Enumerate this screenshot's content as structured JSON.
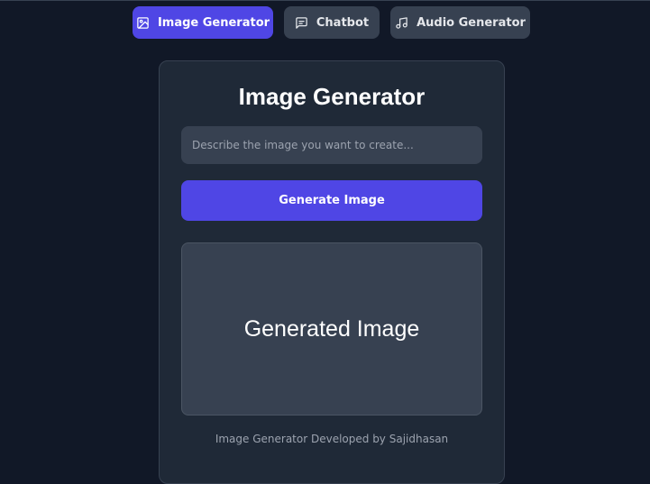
{
  "nav": {
    "tabs": [
      {
        "label": "Image Generator",
        "icon": "image-icon",
        "active": true
      },
      {
        "label": "Chatbot",
        "icon": "chat-icon",
        "active": false
      },
      {
        "label": "Audio Generator",
        "icon": "music-icon",
        "active": false
      }
    ]
  },
  "card": {
    "title": "Image Generator",
    "input_placeholder": "Describe the image you want to create...",
    "input_value": "",
    "button_label": "Generate Image",
    "image_placeholder": "Generated Image",
    "footer": "Image Generator Developed by Sajidhasan"
  },
  "colors": {
    "background": "#111827",
    "card": "#1f2937",
    "accent": "#4f46e5",
    "input": "#374151"
  }
}
